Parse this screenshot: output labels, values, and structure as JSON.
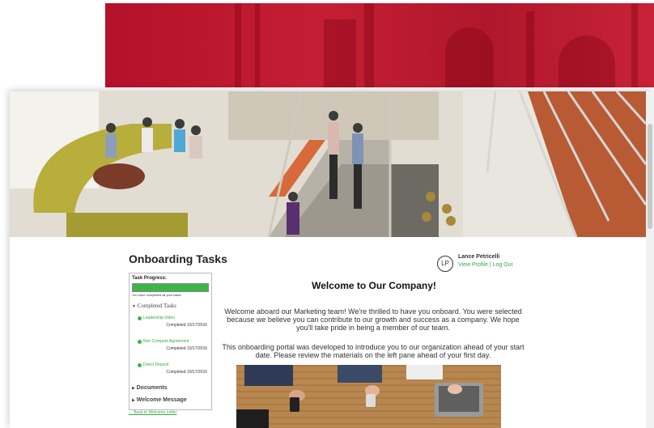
{
  "page": {
    "title": "Onboarding Tasks"
  },
  "user": {
    "initials": "LP",
    "name": "Lance Petricelli",
    "view_profile": "View Profile",
    "separator": " | ",
    "log_out": "Log Out"
  },
  "progress": {
    "label": "Task Progress:",
    "value_fraction": 1.0,
    "note": "You have completed all your tasks."
  },
  "sections": {
    "completed": "Completed Tasks",
    "documents": "Documents",
    "welcome_message": "Welcome Message",
    "collapsed_arrow": "▶",
    "expanded_arrow": "▼"
  },
  "tasks": [
    {
      "name": "Leadership Video",
      "completed": "Completed 10/17/2016"
    },
    {
      "name": "Non Compete Agreement",
      "completed": "Completed 10/17/2016"
    },
    {
      "name": "Direct Deposit",
      "completed": "Completed 10/17/2016"
    }
  ],
  "back_link": "← Back to Welcome Letter",
  "main": {
    "heading": "Welcome to Our Company!",
    "para1": "Welcome aboard our Marketing team! We're thrilled to have you onboard. You were selected because we believe you can contribute to our growth and success as a company. We hope you'll take pride in being a member of our team.",
    "para2": "This onboarding portal was developed to introduce you to our organization ahead of your start date. Please review the materials on the left pane ahead of your first day."
  },
  "colors": {
    "accent_green": "#3db54a",
    "banner_red": "#c41e34"
  },
  "icons": {
    "task_status": "green-dot-icon",
    "avatar": "lp-monogram-icon"
  }
}
